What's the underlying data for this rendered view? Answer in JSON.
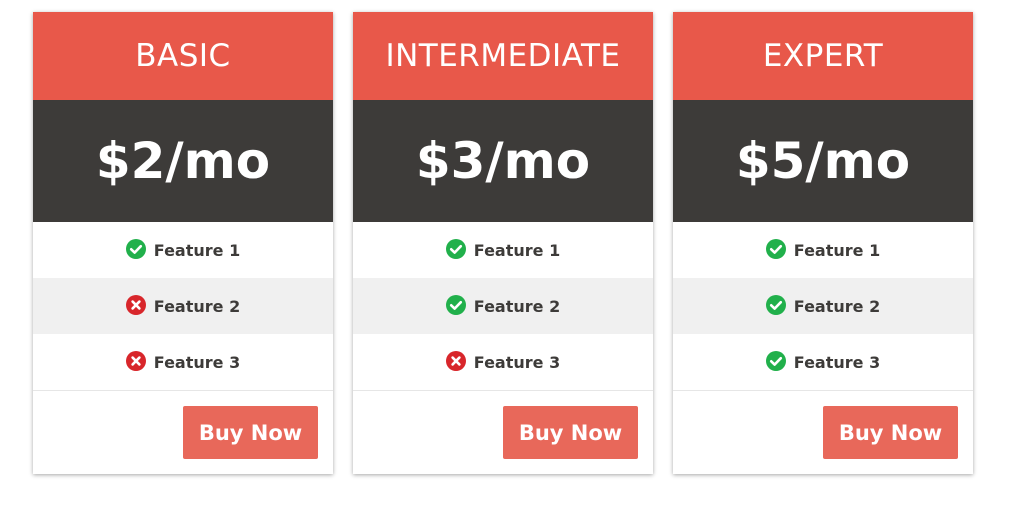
{
  "plans": [
    {
      "name": "BASIC",
      "price": "$2/mo",
      "features": [
        {
          "label": "Feature 1",
          "included": true,
          "icon": "check-circle-icon"
        },
        {
          "label": "Feature 2",
          "included": false,
          "icon": "x-circle-icon"
        },
        {
          "label": "Feature 3",
          "included": false,
          "icon": "x-circle-icon"
        }
      ],
      "button_label": "Buy Now"
    },
    {
      "name": "INTERMEDIATE",
      "price": "$3/mo",
      "features": [
        {
          "label": "Feature 1",
          "included": true,
          "icon": "check-circle-icon"
        },
        {
          "label": "Feature 2",
          "included": true,
          "icon": "check-circle-icon"
        },
        {
          "label": "Feature 3",
          "included": false,
          "icon": "x-circle-icon"
        }
      ],
      "button_label": "Buy Now"
    },
    {
      "name": "EXPERT",
      "price": "$5/mo",
      "features": [
        {
          "label": "Feature 1",
          "included": true,
          "icon": "check-circle-icon"
        },
        {
          "label": "Feature 2",
          "included": true,
          "icon": "check-circle-icon"
        },
        {
          "label": "Feature 3",
          "included": true,
          "icon": "check-circle-icon"
        }
      ],
      "button_label": "Buy Now"
    }
  ],
  "colors": {
    "header_bg": "#e8584a",
    "price_bg": "#3d3b39",
    "button_bg": "#e8685a",
    "check_green": "#21b04b",
    "cross_red": "#d8262b",
    "alt_row_bg": "#f0f0f0"
  }
}
